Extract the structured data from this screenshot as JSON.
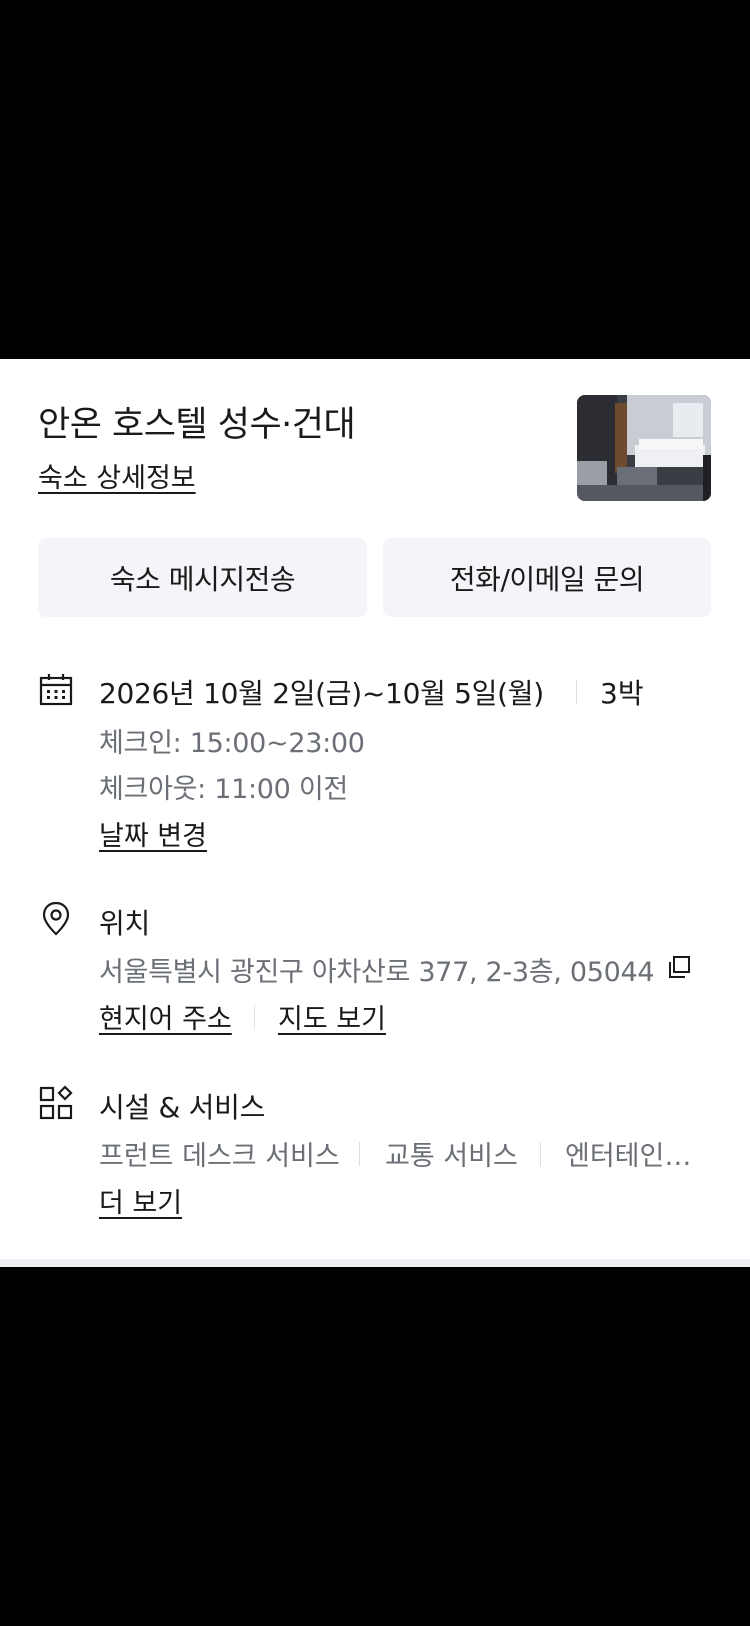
{
  "hotel": {
    "name": "안온 호스텔 성수·건대",
    "detail_link": "숙소 상세정보"
  },
  "buttons": {
    "message": "숙소 메시지전송",
    "contact": "전화/이메일 문의"
  },
  "dates": {
    "range": "2026년 10월 2일(금)~10월 5일(월)",
    "nights": "3박",
    "checkin": "체크인: 15:00~23:00",
    "checkout": "체크아웃: 11:00 이전",
    "change_link": "날짜 변경"
  },
  "location": {
    "title": "위치",
    "address": "서울특별시 광진구 아차산로 377, 2-3층, 05044",
    "local_address_link": "현지어 주소",
    "map_link": "지도 보기"
  },
  "facilities": {
    "title": "시설 & 서비스",
    "items": [
      "프런트 데스크 서비스",
      "교통 서비스",
      "엔터테인…"
    ],
    "more_link": "더 보기"
  },
  "icons": {
    "calendar": "calendar-icon",
    "location": "location-pin-icon",
    "facilities": "grid-services-icon",
    "copy": "copy-icon"
  },
  "colors": {
    "text_primary": "#1a1a1a",
    "text_secondary": "#6b6f76",
    "button_bg": "#f3f5f8"
  }
}
